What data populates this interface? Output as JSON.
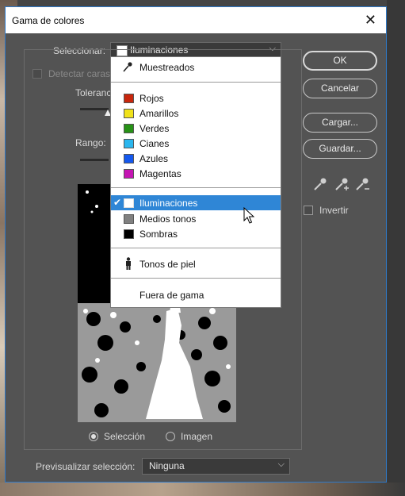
{
  "window": {
    "title": "Gama de colores",
    "close_glyph": "✕"
  },
  "select_row": {
    "label": "Seleccionar:",
    "value": "Iluminaciones"
  },
  "left_panel": {
    "detect_faces": "Detectar caras",
    "tolerance": "Toleranc",
    "range": "Rango:"
  },
  "buttons": {
    "ok": "OK",
    "cancel": "Cancelar",
    "load": "Cargar...",
    "save": "Guardar..."
  },
  "invert_label": "Invertir",
  "radios": {
    "selection": "Selección",
    "image": "Imagen",
    "selected": "selection"
  },
  "preview_select": {
    "label": "Previsualizar selección:",
    "value": "Ninguna"
  },
  "menu": {
    "sampled": "Muestreados",
    "colors": [
      {
        "label": "Rojos",
        "color": "#c8260c"
      },
      {
        "label": "Amarillos",
        "color": "#f0e21a"
      },
      {
        "label": "Verdes",
        "color": "#279216"
      },
      {
        "label": "Cianes",
        "color": "#2ab6ee"
      },
      {
        "label": "Azules",
        "color": "#1458ee"
      },
      {
        "label": "Magentas",
        "color": "#c515b3"
      }
    ],
    "tones": [
      {
        "label": "Iluminaciones",
        "color": "#ffffff",
        "selected": true
      },
      {
        "label": "Medios tonos",
        "color": "#808080",
        "selected": false
      },
      {
        "label": "Sombras",
        "color": "#000000",
        "selected": false
      }
    ],
    "skin": "Tonos de piel",
    "out_of_gamut": "Fuera de gama",
    "checkmark": "✔"
  }
}
